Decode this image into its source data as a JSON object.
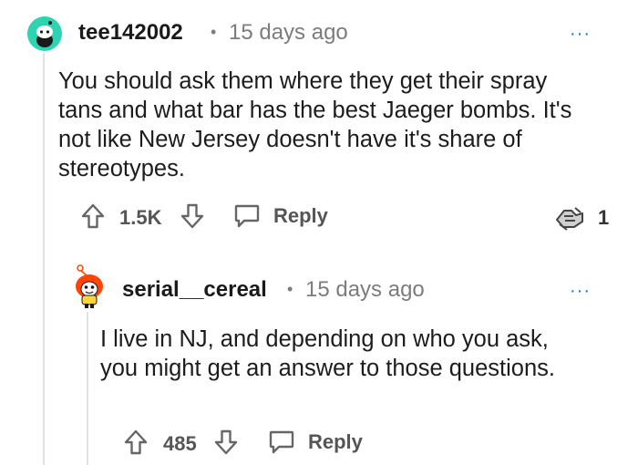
{
  "comments": [
    {
      "username": "tee142002",
      "separator": "•",
      "timestamp": "15 days ago",
      "more": "···",
      "body": "You should ask them where they get their spray tans and what bar has the best Jaeger bombs. It's not like New Jersey doesn't have it's share of stereotypes.",
      "votes": "1.5K",
      "reply_label": "Reply",
      "award_count": "1",
      "avatar_color": "#2ed3b1"
    },
    {
      "username": "serial__cereal",
      "separator": "•",
      "timestamp": "15 days ago",
      "more": "···",
      "body": "I live in NJ, and depending on who you ask, you might get an answer to those questions.",
      "votes": "485",
      "reply_label": "Reply",
      "avatar_color": "#ff4500"
    }
  ],
  "colors": {
    "accent": "#0079d3",
    "meta": "#7c7c7c",
    "thread_line": "#e0e3e6"
  },
  "icons": [
    "upvote-icon",
    "downvote-icon",
    "reply-icon",
    "award-icon",
    "more-icon"
  ]
}
